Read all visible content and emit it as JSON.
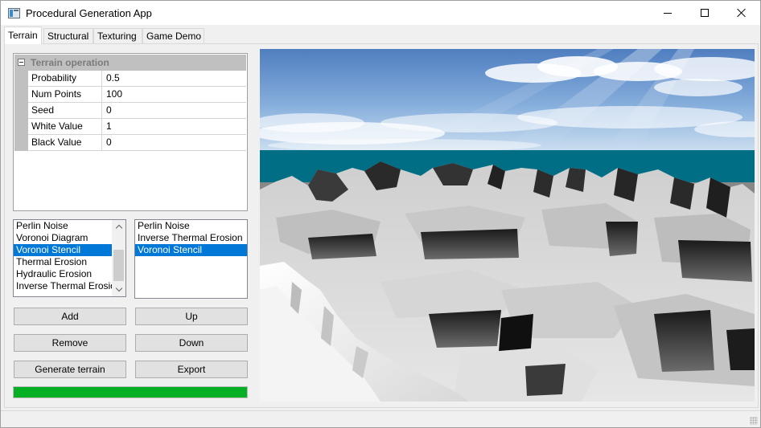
{
  "window": {
    "title": "Procedural Generation App"
  },
  "tabs": [
    "Terrain",
    "Structural",
    "Texturing",
    "Game Demo"
  ],
  "active_tab": "Terrain",
  "property_grid": {
    "category": "Terrain operation",
    "rows": [
      {
        "name": "Probability",
        "value": "0.5"
      },
      {
        "name": "Num Points",
        "value": "100"
      },
      {
        "name": "Seed",
        "value": "0"
      },
      {
        "name": "White Value",
        "value": "1"
      },
      {
        "name": "Black Value",
        "value": "0"
      }
    ]
  },
  "available_operations": {
    "items": [
      "Perlin Noise",
      "Voronoi Diagram",
      "Voronoi Stencil",
      "Thermal Erosion",
      "Hydraulic Erosion",
      "Inverse Thermal Erosion"
    ],
    "selected": "Voronoi Stencil"
  },
  "pipeline": {
    "items": [
      "Perlin Noise",
      "Inverse Thermal Erosion",
      "Voronoi Stencil"
    ],
    "selected": "Voronoi Stencil"
  },
  "buttons": {
    "add": "Add",
    "up": "Up",
    "remove": "Remove",
    "down": "Down",
    "generate": "Generate terrain",
    "export": "Export"
  },
  "progress": {
    "value": 1.0
  },
  "colors": {
    "progress": "#06b025",
    "selection": "#0078d7",
    "sea": "#006f86",
    "sky": "#7aa3d2"
  },
  "icons": {
    "app": "app-icon",
    "minimize": "minimize-icon",
    "maximize": "maximize-icon",
    "close": "close-icon",
    "collapse": "collapse-minus-icon",
    "scroll_up": "chevron-up-icon",
    "scroll_down": "chevron-down-icon",
    "resize_grip": "resize-grip-icon"
  }
}
